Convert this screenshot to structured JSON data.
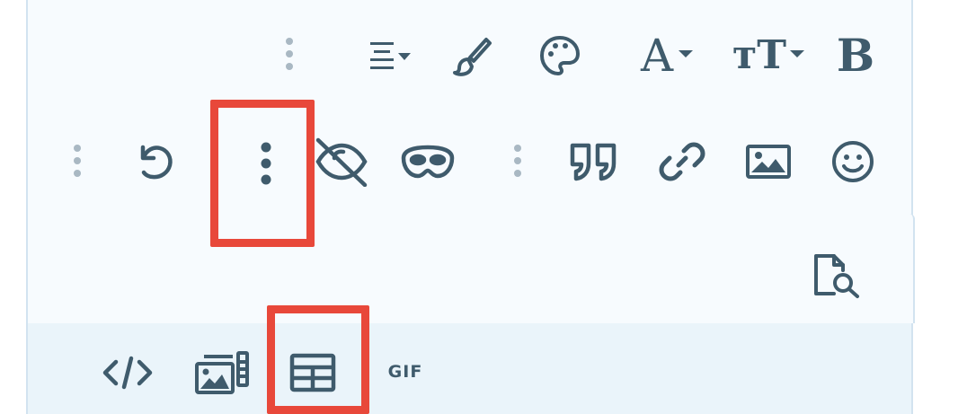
{
  "toolbar": {
    "row1": {
      "align_icon": "align-icon",
      "style_icon": "paintbrush-icon",
      "color_icon": "palette-icon",
      "font_family_label": "A",
      "font_size_label": "тT",
      "bold_label": "B"
    },
    "row2": {
      "undo_icon": "undo-icon",
      "more_icon": "more-vertical-icon",
      "hide_icon": "eye-slash-icon",
      "spoiler_icon": "mask-icon",
      "quote_icon": "quote-icon",
      "link_icon": "link-icon",
      "image_icon": "image-icon",
      "emoji_icon": "smiley-icon"
    },
    "row3": {
      "preview_icon": "file-search-icon"
    }
  },
  "attachments": {
    "code_icon": "code-icon",
    "media_icon": "media-gallery-icon",
    "table_icon": "table-icon",
    "gif_label": "GIF"
  },
  "colors": {
    "icon": "#3f5b6c",
    "separator": "#a9b8c3",
    "editor_bg": "#f7fbfe",
    "attach_bg": "#eaf4fa",
    "border": "#d2e3f0",
    "highlight": "#e8483a"
  }
}
